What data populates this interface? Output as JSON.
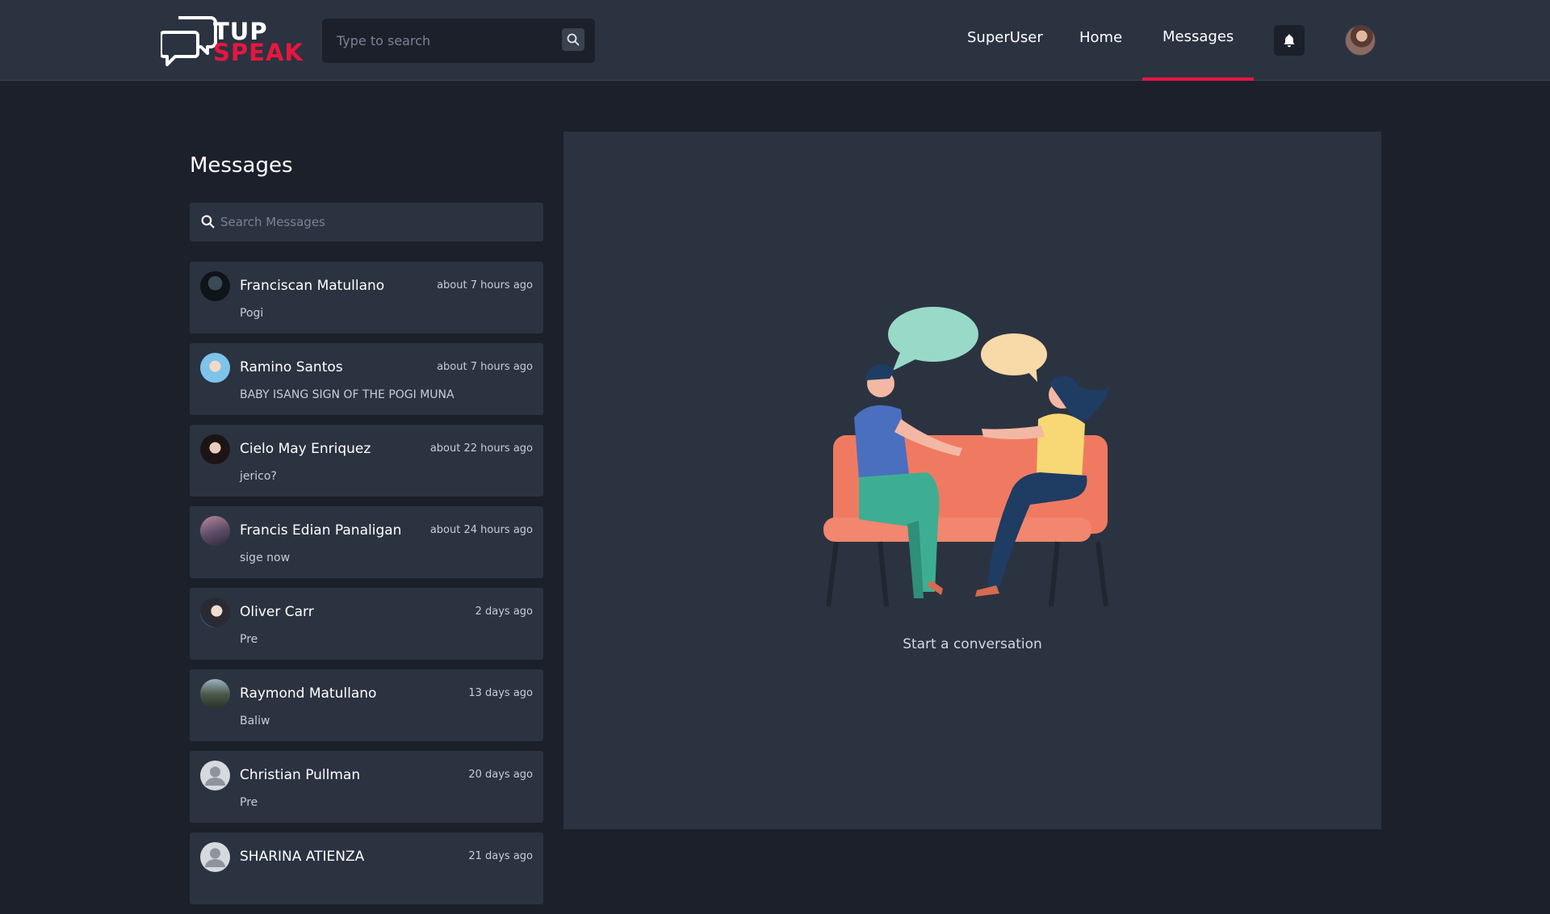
{
  "header": {
    "logo": {
      "line1": "TUP",
      "line2": "SPEAK"
    },
    "search": {
      "placeholder": "Type to search"
    },
    "nav": [
      {
        "label": "SuperUser"
      },
      {
        "label": "Home"
      },
      {
        "label": "Messages",
        "active": true
      }
    ]
  },
  "sidebar": {
    "title": "Messages",
    "search": {
      "placeholder": "Search Messages"
    },
    "conversations": [
      {
        "name": "Franciscan Matullano",
        "time": "about 7 hours ago",
        "preview": "Pogi"
      },
      {
        "name": "Ramino Santos",
        "time": "about 7 hours ago",
        "preview": "BABY ISANG SIGN OF THE POGI MUNA"
      },
      {
        "name": "Cielo May Enriquez",
        "time": "about 22 hours ago",
        "preview": "jerico?"
      },
      {
        "name": "Francis Edian Panaligan",
        "time": "about 24 hours ago",
        "preview": "sige now"
      },
      {
        "name": "Oliver Carr",
        "time": "2 days ago",
        "preview": "Pre"
      },
      {
        "name": "Raymond Matullano",
        "time": "13 days ago",
        "preview": "Baliw"
      },
      {
        "name": "Christian Pullman",
        "time": "20 days ago",
        "preview": "Pre"
      },
      {
        "name": "SHARINA ATIENZA",
        "time": "21 days ago",
        "preview": ""
      }
    ]
  },
  "main": {
    "empty_state_text": "Start a conversation"
  },
  "colors": {
    "accent": "#e8163f",
    "header_bg": "#2b3341",
    "page_bg": "#1b202b",
    "card_bg": "#2b3341"
  },
  "icons": {
    "search": "search-icon",
    "bell": "bell-icon",
    "avatar_placeholder": "user-placeholder-icon"
  }
}
